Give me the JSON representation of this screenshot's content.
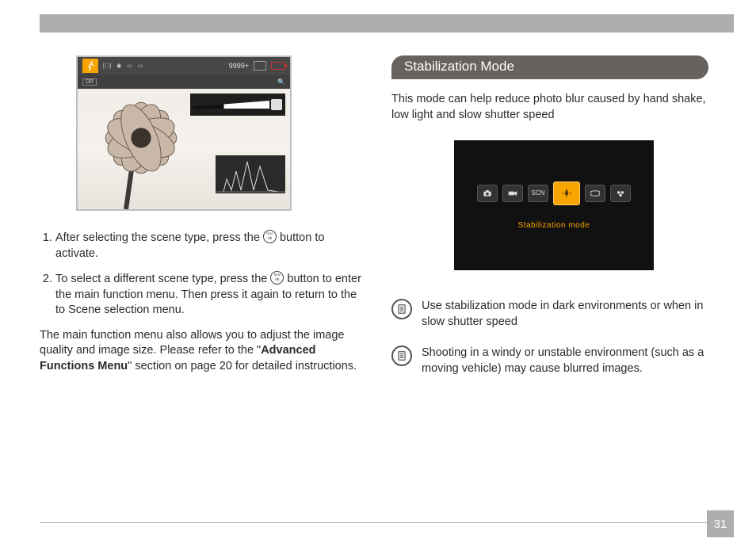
{
  "page_number": "31",
  "left": {
    "lcd": {
      "counter": "9999+",
      "dr_label": "DR",
      "icons": {
        "sport": "running-person-icon",
        "focus": "focus-area-icon",
        "meter": "spot-meter-icon",
        "aspect1": "aspect-icon",
        "aspect2": "aspect-icon",
        "card": "sd-card-icon",
        "battery": "battery-low-icon",
        "magnify": "🔍",
        "zoom_magnify": "🔍"
      }
    },
    "steps": {
      "1a": "After selecting the scene type, press the ",
      "1b": " button to activate.",
      "2a": "To select a different scene type, press the ",
      "2b": " button to enter the main function menu. Then press it again to return to the to Scene selection menu."
    },
    "para_a": "The main function menu also allows you to adjust the image quality and image size. Please refer to the \"",
    "para_bold": "Advanced Functions Menu",
    "para_b": "\" section on page 20 for detailed instructions."
  },
  "right": {
    "heading": "Stabilization Mode",
    "desc": "This mode can help reduce photo blur caused by hand shake, low light and slow shutter speed",
    "mode_lcd": {
      "chips": {
        "camera": "camera-icon",
        "film": "film-icon",
        "scn": "SCN",
        "stab": "stabilization-icon",
        "pano": "panorama-icon",
        "fx": "effects-icon"
      },
      "label": "Stabilization mode"
    },
    "notes": {
      "1": "Use stabilization mode in dark environments or when in slow shutter speed",
      "2": "Shooting in a windy or unstable environment (such as a moving vehicle) may cause blurred images."
    }
  }
}
